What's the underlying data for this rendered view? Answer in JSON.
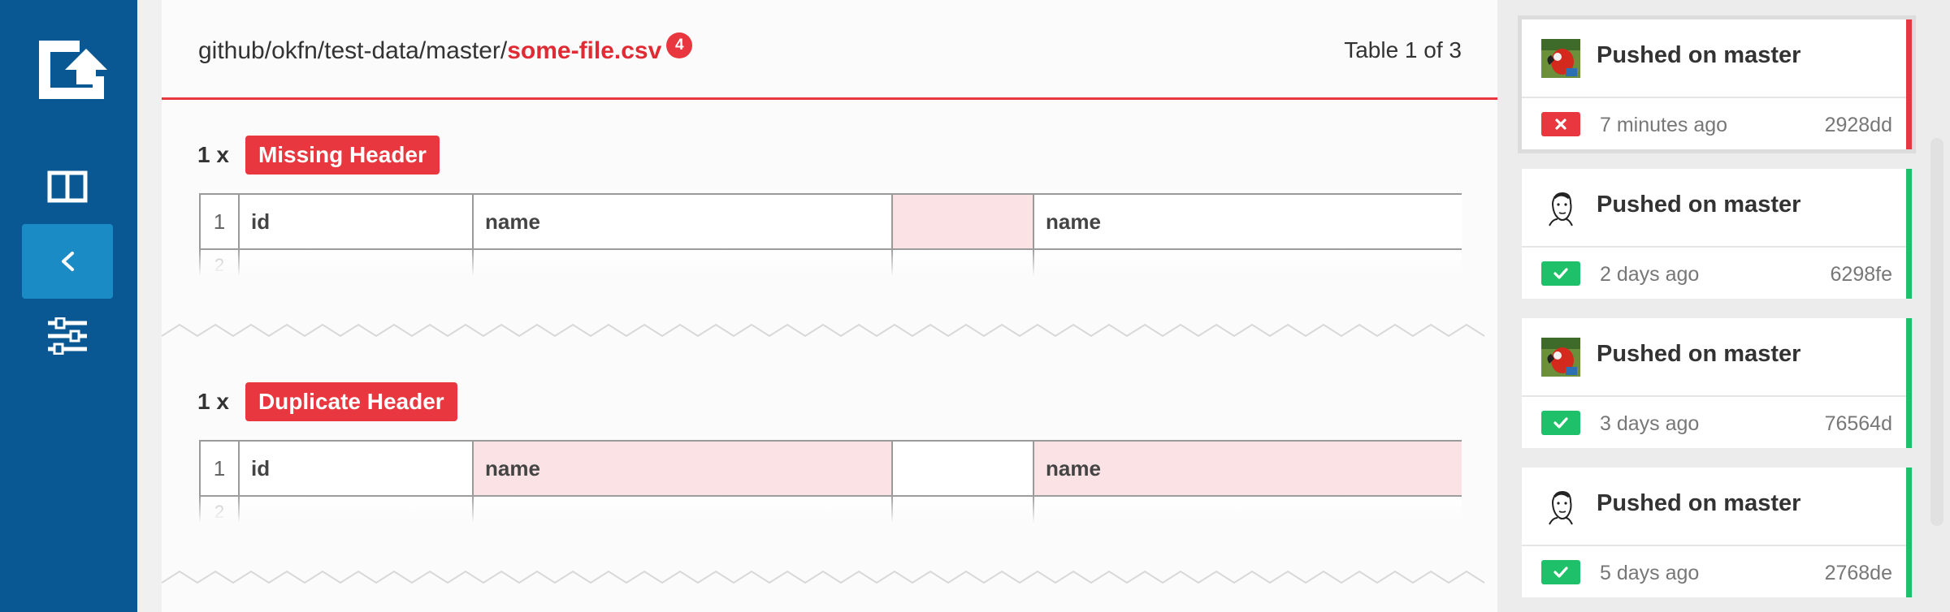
{
  "header": {
    "path_prefix": "github/okfn/test-data/master/",
    "filename": "some-file.csv",
    "error_count": "4",
    "table_counter": "Table 1 of 3"
  },
  "errors": [
    {
      "count": "1 x",
      "label": "Missing Header",
      "row_number": "1",
      "cells": [
        "id",
        "name",
        "",
        "name"
      ],
      "next_row": "2"
    },
    {
      "count": "1 x",
      "label": "Duplicate Header",
      "row_number": "1",
      "cells": [
        "id",
        "name",
        "",
        "name"
      ],
      "next_row": "2"
    }
  ],
  "commits": [
    {
      "title": "Pushed on master",
      "time": "7 minutes ago",
      "hash": "2928dd",
      "status": "fail",
      "avatar": "parrot-avatar"
    },
    {
      "title": "Pushed on master",
      "time": "2 days ago",
      "hash": "6298fe",
      "status": "ok",
      "avatar": "sketch-avatar"
    },
    {
      "title": "Pushed on master",
      "time": "3 days ago",
      "hash": "76564d",
      "status": "ok",
      "avatar": "parrot-avatar"
    },
    {
      "title": "Pushed on master",
      "time": "5 days ago",
      "hash": "2768de",
      "status": "ok",
      "avatar": "sketch-avatar"
    }
  ],
  "colors": {
    "sidebar": "#0a5893",
    "accent_red": "#e8373f",
    "success_green": "#1fc06a",
    "active_nav": "#1a8bc4",
    "error_cell": "#fbe3e5"
  },
  "icons": {
    "logo": "logo-icon",
    "nav_1": "columns-icon",
    "nav_2": "chevron-left-icon",
    "nav_3": "sliders-icon"
  }
}
